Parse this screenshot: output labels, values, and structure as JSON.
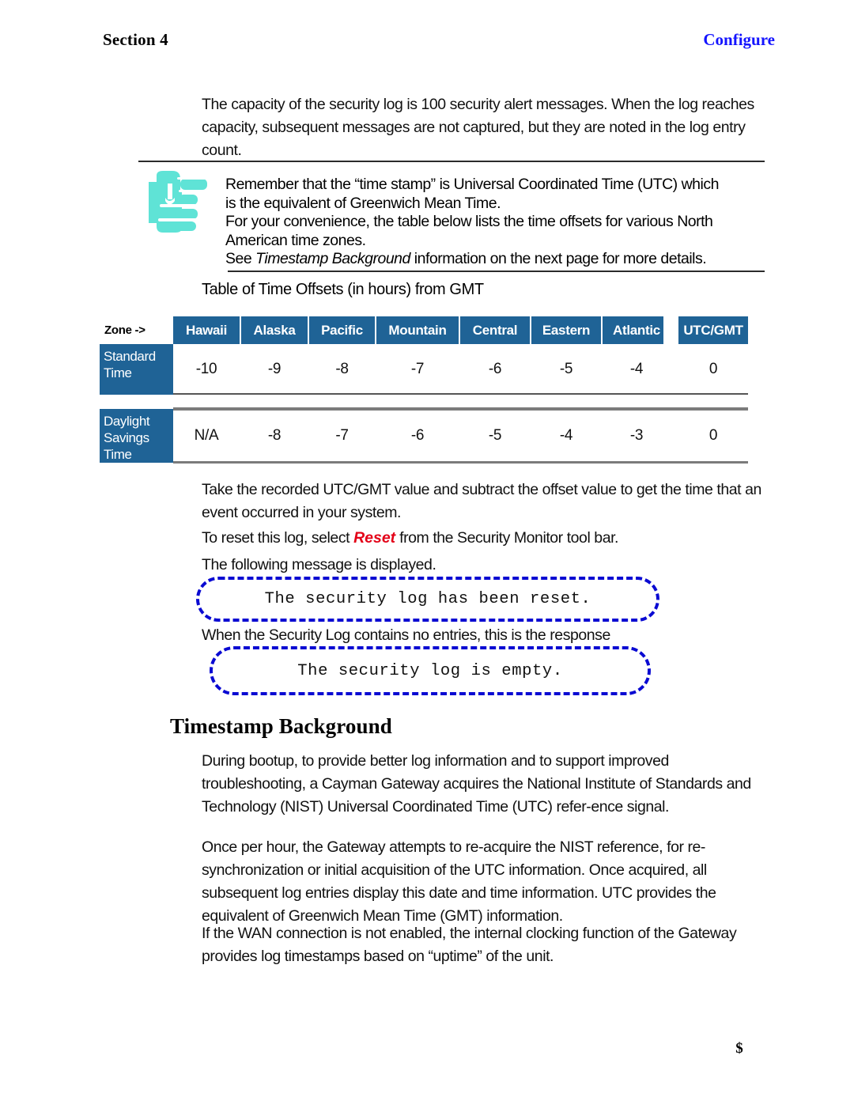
{
  "running_head": {
    "left": "Section 4",
    "right": "Configure",
    "right_color": "#1414ff"
  },
  "intro_paragraph": "The capacity of the security log is 100 security alert messages. When the log reaches capacity, subsequent messages are not captured, but they are noted in the log entry count.",
  "note": {
    "icon": "pointing-hand-icon",
    "icon_color": "#5FE3D6",
    "lines": [
      "Remember that the “time stamp” is Universal Coordinated Time (UTC) which",
      "is the equivalent of Greenwich Mean Time.",
      "For your convenience, the table below lists the time offsets for various North",
      "American time zones."
    ],
    "last_line_prefix": "See ",
    "last_line_italic": "Timestamp Background",
    "last_line_suffix": " information on the next page for more details."
  },
  "table_caption": "Table of Time Offsets (in hours) from GMT",
  "chart_data": {
    "type": "table",
    "title": "Table of Time Offsets (in hours) from GMT",
    "corner_label": "Zone ->",
    "categories": [
      "Hawaii",
      "Alaska",
      "Pacific",
      "Mountain",
      "Central",
      "Eastern",
      "Atlantic",
      "UTC/GMT"
    ],
    "series": [
      {
        "name": "Standard Time",
        "values": [
          "-10",
          "-9",
          "-8",
          "-7",
          "-6",
          "-5",
          "-4",
          "0"
        ]
      },
      {
        "name": "Daylight Savings Time",
        "values": [
          "N/A",
          "-8",
          "-7",
          "-6",
          "-5",
          "-4",
          "-3",
          "0"
        ]
      }
    ],
    "header_color": "#1F6396",
    "header_text_color": "#ffffff",
    "row_label_lines": [
      [
        "Standard",
        "Time"
      ],
      [
        "Daylight",
        "Savings",
        "Time"
      ]
    ]
  },
  "paragraphs": {
    "take": "Take the recorded UTC/GMT value and subtract the offset value to get the time that an event occurred in your system.",
    "reset_prefix": "To reset this log, select ",
    "reset_word": "Reset",
    "reset_suffix": " from the Security Monitor tool bar.",
    "following": "The following message is displayed.",
    "when_empty": "When the Security Log contains no entries, this is the response",
    "during": "During bootup, to provide better log information and to support improved troubleshooting, a Cayman Gateway acquires the National Institute of Standards and Technology (NIST) Universal Coordinated Time (UTC) refer-ence signal.",
    "once": "Once per hour, the Gateway attempts to re-acquire the NIST reference, for re-synchronization or initial acquisition of the UTC information. Once acquired, all subsequent log entries display this date and time information. UTC provides the equivalent of Greenwich Mean Time (GMT) information.",
    "if_wan": "If the WAN connection is not enabled, the internal clocking function of the Gateway provides log timestamps based on “uptime” of the unit."
  },
  "message_boxes": [
    {
      "text": "The security log has been reset.",
      "border_color": "#0a0ad2"
    },
    {
      "text": "The security log is empty.",
      "border_color": "#0a0ad2"
    }
  ],
  "subheading": "Timestamp Background",
  "footer": "$",
  "colors": {
    "table_blue": "#1F6396",
    "link_blue": "#1414ff",
    "reset_red": "#e30017",
    "hand_teal": "#5FE3D6"
  }
}
